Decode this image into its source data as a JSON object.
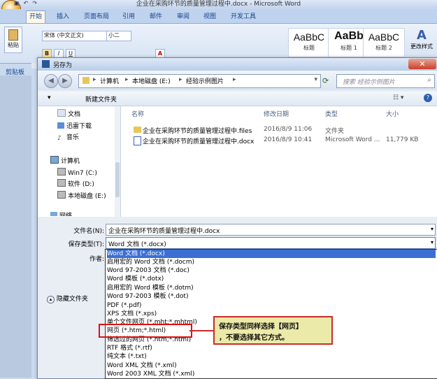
{
  "word": {
    "title": "企业在采购环节的质量管理过程中.docx - Microsoft Word",
    "tabs": [
      "开始",
      "插入",
      "页面布局",
      "引用",
      "邮件",
      "审阅",
      "视图",
      "开发工具"
    ],
    "font_name": "宋体 (中文正文)",
    "font_size": "小二",
    "paste_label": "粘贴",
    "clipboard_label": "剪贴板",
    "styles": [
      {
        "sample": "AaBbC",
        "label": "标题"
      },
      {
        "sample": "AaBb",
        "label": "标题 1"
      },
      {
        "sample": "AaBbC",
        "label": "标题 2"
      }
    ],
    "change_styles": "更改样式"
  },
  "dialog": {
    "title": "另存为",
    "breadcrumb": [
      "计算机",
      "本地磁盘 (E:)",
      "经验示例图片"
    ],
    "search_placeholder": "搜索 经验示例图片",
    "new_folder": "新建文件夹",
    "nav": {
      "documents": "文档",
      "downloads": "迅雷下载",
      "music": "音乐",
      "computer": "计算机",
      "drive_c": "Win7 (C:)",
      "drive_d": "软件 (D:)",
      "drive_e": "本地磁盘 (E:)",
      "network": "网络"
    },
    "columns": {
      "name": "名称",
      "modified": "修改日期",
      "type": "类型",
      "size": "大小"
    },
    "files": [
      {
        "name": "企业在采购环节的质量管理过程中.files",
        "modified": "2016/8/9 11:06",
        "type": "文件夹",
        "size": ""
      },
      {
        "name": "企业在采购环节的质量管理过程中.docx",
        "modified": "2016/8/9 10:41",
        "type": "Microsoft Word ...",
        "size": "11,779 KB"
      }
    ],
    "filename_label": "文件名(N):",
    "filename_value": "企业在采购环节的质量管理过程中.docx",
    "filetype_label": "保存类型(T):",
    "filetype_value": "Word 文档 (*.docx)",
    "author_label": "作者:",
    "hide_folders": "隐藏文件夹",
    "filetype_options": [
      "Word 文档 (*.docx)",
      "启用宏的 Word 文档 (*.docm)",
      "Word 97-2003 文档 (*.doc)",
      "Word 模板 (*.dotx)",
      "启用宏的 Word 模板 (*.dotm)",
      "Word 97-2003 模板 (*.dot)",
      "PDF (*.pdf)",
      "XPS 文档 (*.xps)",
      "单个文件网页 (*.mht;*.mhtml)",
      "网页 (*.htm;*.html)",
      "筛选过的网页 (*.htm;*.html)",
      "RTF 格式 (*.rtf)",
      "纯文本 (*.txt)",
      "Word XML 文档 (*.xml)",
      "Word 2003 XML 文档 (*.xml)"
    ]
  },
  "annotation": {
    "line1": "保存类型同样选择【网页】",
    "line2": "，不要选择其它方式。",
    "color": "#cc2a2a"
  }
}
